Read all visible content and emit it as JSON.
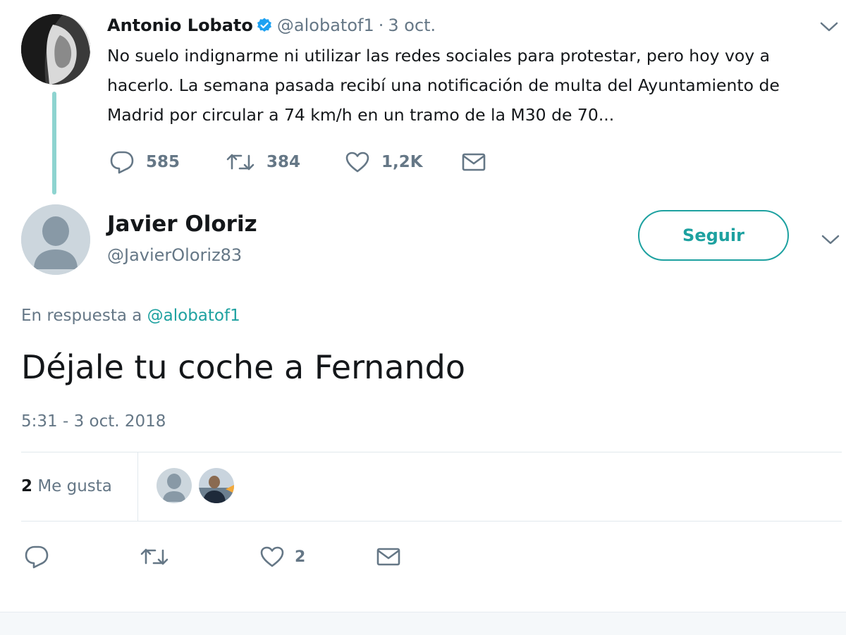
{
  "parent_tweet": {
    "author_name": "Antonio Lobato",
    "handle": "@alobatof1",
    "separator": "·",
    "date": "3 oct.",
    "text": "No suelo indignarme ni utilizar las redes sociales para protestar, pero hoy voy a hacerlo. La semana pasada recibí una notificación de multa del Ayuntamiento de Madrid por circular a 74 km/h en un tramo de la M30 de 70...",
    "replies": "585",
    "retweets": "384",
    "likes": "1,2K"
  },
  "reply_tweet": {
    "author_name": "Javier Oloriz",
    "handle": "@JavierOloriz83",
    "follow_label": "Seguir",
    "reply_prefix": "En respuesta a",
    "reply_mention": "@alobatof1",
    "text": "Déjale tu coche a Fernando",
    "timestamp": "5:31 - 3 oct. 2018",
    "likes_count": "2",
    "likes_label": "Me gusta",
    "action_likes": "2"
  },
  "icons": {
    "reply": "reply-icon",
    "retweet": "retweet-icon",
    "like": "heart-icon",
    "dm": "mail-icon",
    "caret": "chevron-down-icon",
    "verified": "verified-badge-icon"
  },
  "colors": {
    "accent": "#1da1a0",
    "verified": "#1da1f2",
    "secondary_text": "#657786",
    "thread_line": "#8ed4d0"
  }
}
